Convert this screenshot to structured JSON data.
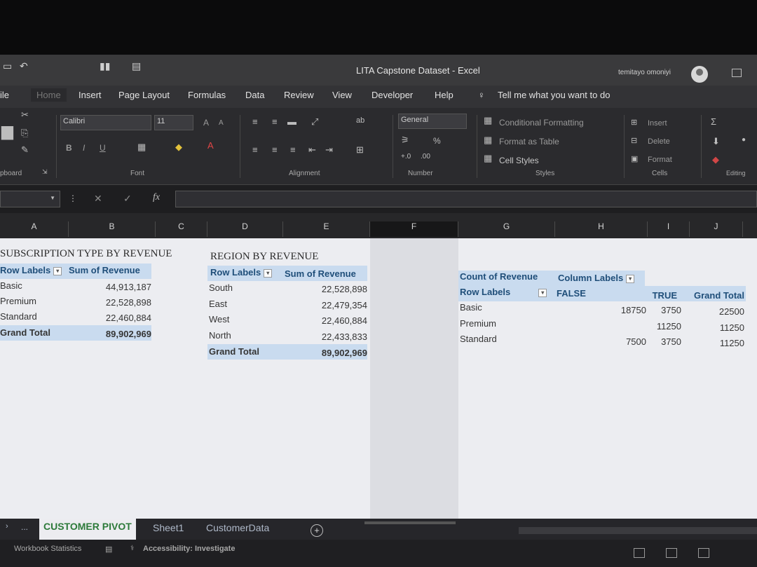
{
  "titlebar": {
    "doc_title": "LITA Capstone Dataset  -  Excel",
    "user_name": "temitayo omoniyi"
  },
  "ribbon_tabs": [
    "ile",
    "Home",
    "Insert",
    "Page Layout",
    "Formulas",
    "Data",
    "Review",
    "View",
    "Developer",
    "Help"
  ],
  "tell_me": "Tell me what you want to do",
  "ribbon": {
    "font_name": "Calibri",
    "font_size": "11",
    "number_format": "General",
    "percent": "%",
    "conditional_formatting": "Conditional Formatting",
    "format_as_table": "Format as Table",
    "cell_styles": "Cell Styles",
    "insert": "Insert",
    "delete": "Delete",
    "format": "Format",
    "bold": "B",
    "italic": "I",
    "underline": "U",
    "groups": {
      "clipboard": "pboard",
      "font": "Font",
      "alignment": "Alignment",
      "number": "Number",
      "styles": "Styles",
      "cells": "Cells",
      "editing": "Editing"
    }
  },
  "formula_bar": {
    "fx": "fx"
  },
  "columns": [
    "A",
    "B",
    "C",
    "D",
    "E",
    "F",
    "G",
    "H",
    "I",
    "J"
  ],
  "pivot1": {
    "title": "SUBSCRIPTION TYPE BY REVENUE",
    "col1": "Row Labels",
    "col2": "Sum of Revenue",
    "rows": [
      {
        "label": "Basic",
        "value": "44,913,187"
      },
      {
        "label": "Premium",
        "value": "22,528,898"
      },
      {
        "label": "Standard",
        "value": "22,460,884"
      }
    ],
    "total_label": "Grand Total",
    "total_value": "89,902,969"
  },
  "pivot2": {
    "title": "REGION BY REVENUE",
    "col1": "Row Labels",
    "col2": "Sum of Revenue",
    "rows": [
      {
        "label": "South",
        "value": "22,528,898"
      },
      {
        "label": "East",
        "value": "22,479,354"
      },
      {
        "label": "West",
        "value": "22,460,884"
      },
      {
        "label": "North",
        "value": "22,433,833"
      }
    ],
    "total_label": "Grand Total",
    "total_value": "89,902,969"
  },
  "pivot3": {
    "corner": "Count of Revenue",
    "col_labels": "Column Labels",
    "row_labels": "Row Labels",
    "false_label": "FALSE",
    "true_label": "TRUE",
    "grand_total": "Grand Total",
    "rows": [
      {
        "label": "Basic",
        "false": "18750",
        "true": "3750",
        "total": "22500"
      },
      {
        "label": "Premium",
        "false": "",
        "true": "11250",
        "total": "11250"
      },
      {
        "label": "Standard",
        "false": "7500",
        "true": "3750",
        "total": "11250"
      }
    ]
  },
  "sheet_tabs": {
    "ellipsis": "...",
    "tabs": [
      "CUSTOMER PIVOT",
      "Sheet1",
      "CustomerData"
    ],
    "active": "CUSTOMER PIVOT"
  },
  "status": {
    "workbook_statistics": "Workbook Statistics",
    "accessibility": "Accessibility: Investigate"
  }
}
